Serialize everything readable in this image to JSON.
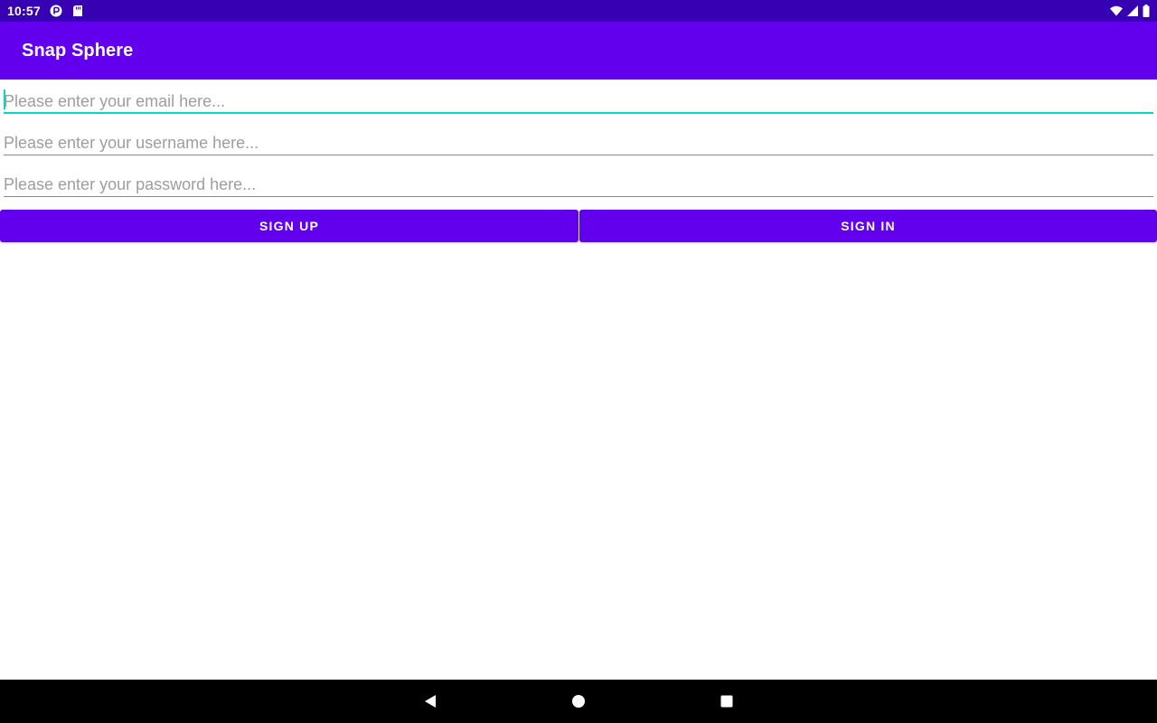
{
  "status_bar": {
    "time": "10:57",
    "icons_left": [
      "app-notification-icon",
      "sd-card-icon"
    ],
    "icons_right": [
      "wifi-icon",
      "signal-icon",
      "battery-icon"
    ]
  },
  "app_bar": {
    "title": "Snap Sphere"
  },
  "form": {
    "email_placeholder": "Please enter your email here...",
    "username_placeholder": "Please enter your username here...",
    "password_placeholder": "Please enter your password here...",
    "email_value": "",
    "username_value": "",
    "password_value": ""
  },
  "buttons": {
    "sign_up": "SIGN UP",
    "sign_in": "SIGN IN"
  },
  "nav_bar": {
    "icons": [
      "back-icon",
      "home-icon",
      "recents-icon"
    ]
  },
  "colors": {
    "status_bar": "#3700b3",
    "primary": "#6200ee",
    "accent": "#03dac5",
    "nav_bar": "#000000"
  }
}
